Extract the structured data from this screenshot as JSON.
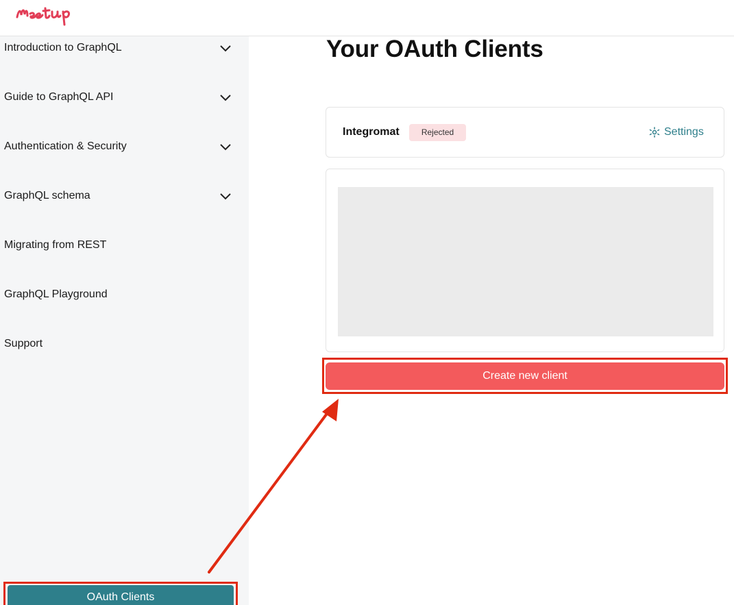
{
  "header": {
    "logo_text": "Meetup",
    "logo_color": "#e23e57"
  },
  "sidebar": {
    "items": [
      {
        "label": "Introduction to GraphQL",
        "expandable": true
      },
      {
        "label": "Guide to GraphQL API",
        "expandable": true
      },
      {
        "label": "Authentication & Security",
        "expandable": true
      },
      {
        "label": "GraphQL schema",
        "expandable": true
      },
      {
        "label": "Migrating from REST",
        "expandable": false
      },
      {
        "label": "GraphQL Playground",
        "expandable": false
      },
      {
        "label": "Support",
        "expandable": false
      }
    ],
    "oauth_button_label": "OAuth Clients"
  },
  "main": {
    "title": "Your OAuth Clients",
    "client": {
      "name": "Integromat",
      "status": "Rejected",
      "settings_label": "Settings"
    },
    "create_button_label": "Create new client"
  },
  "colors": {
    "accent_teal": "#2e7f8b",
    "create_red": "#f35a5c",
    "highlight_red": "#e02b12",
    "badge_bg": "#fbe0e2"
  }
}
